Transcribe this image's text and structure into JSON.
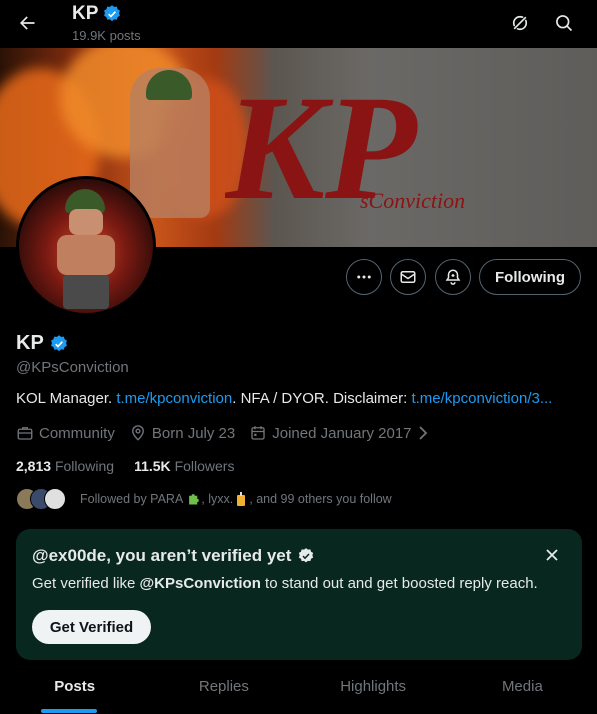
{
  "header": {
    "name": "KP",
    "posts_count": "19.9K posts"
  },
  "profile": {
    "display_name": "KP",
    "handle": "@KPsConviction",
    "bio_prefix": "KOL Manager. ",
    "bio_link1": "t.me/kpconviction",
    "bio_middle": ". NFA / DYOR. Disclaimer: ",
    "bio_link2": "t.me/kpconviction/3...",
    "category": "Community",
    "birthday": "Born July 23",
    "joined": "Joined January 2017",
    "following_count": "2,813",
    "following_label": "Following",
    "followers_count": "11.5K",
    "followers_label": "Followers",
    "followed_by": "Followed by PARA",
    "followed_by_mid": ", lyxx.",
    "followed_by_tail": ", and 99 others you follow",
    "follow_button": "Following",
    "banner_text": "KP",
    "banner_subtext": "sConviction"
  },
  "verify_card": {
    "title": "@ex00de, you aren’t verified yet",
    "text_prefix": "Get verified like ",
    "text_handle": "@KPsConviction",
    "text_suffix": " to stand out and get boosted reply reach.",
    "button": "Get Verified"
  },
  "tabs": [
    {
      "label": "Posts",
      "active": true
    },
    {
      "label": "Replies",
      "active": false
    },
    {
      "label": "Highlights",
      "active": false
    },
    {
      "label": "Media",
      "active": false
    }
  ],
  "colors": {
    "accent": "#1d9bf0",
    "card_bg": "#07271f",
    "muted": "#71767b"
  },
  "icons": [
    "back-arrow-icon",
    "verified-badge-icon",
    "grok-icon",
    "search-icon",
    "more-icon",
    "message-icon",
    "notification-bell-icon",
    "briefcase-icon",
    "location-pin-icon",
    "calendar-icon",
    "close-icon"
  ]
}
